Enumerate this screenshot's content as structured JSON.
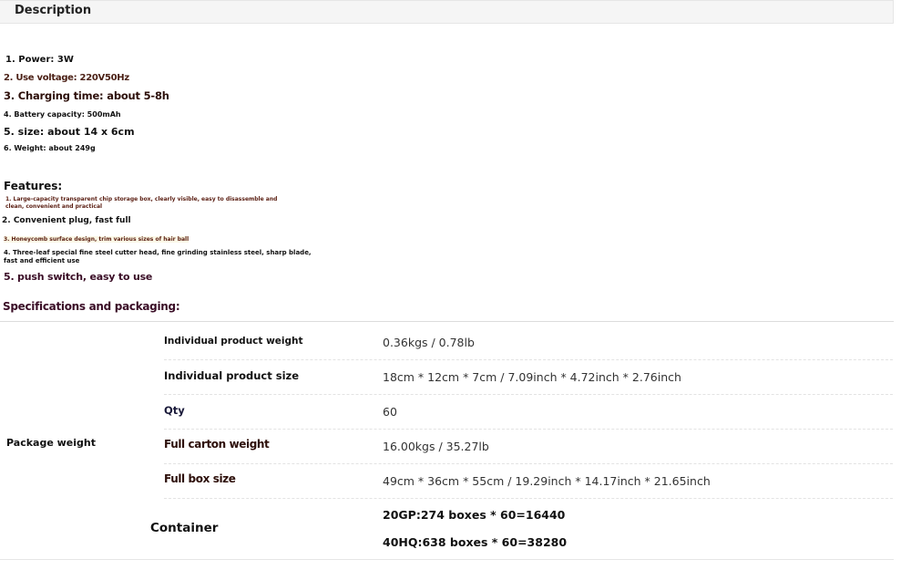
{
  "header": {
    "title": "Description"
  },
  "specs": [
    "1. Power: 3W",
    "2. Use voltage: 220V50Hz",
    "3. Charging time: about 5-8h",
    "4. Battery capacity: 500mAh",
    "5. size: about 14 x 6cm",
    "6. Weight: about 249g"
  ],
  "features": {
    "title": "Features:",
    "items": [
      "1. Large-capacity transparent chip storage box, clearly visible, easy to disassemble and clean, convenient and practical",
      "2. Convenient plug, fast full",
      "3. Honeycomb surface design, trim various sizes of hair ball",
      "4. Three-leaf special fine steel cutter head, fine grinding stainless steel, sharp blade, fast and efficient use",
      "5. push switch, easy to use"
    ]
  },
  "packaging": {
    "title": "Specifications and packaging:",
    "group_label": "Package weight",
    "rows": [
      {
        "label": "Individual product weight",
        "value": "0.36kgs / 0.78lb"
      },
      {
        "label": "Individual product size",
        "value": "18cm * 12cm * 7cm / 7.09inch * 4.72inch * 2.76inch"
      },
      {
        "label": "Qty",
        "value": "60"
      },
      {
        "label": "Full carton weight",
        "value": "16.00kgs / 35.27lb"
      },
      {
        "label": "Full box size",
        "value": "49cm * 36cm * 55cm / 19.29inch * 14.17inch * 21.65inch"
      }
    ],
    "container": {
      "label": "Container",
      "values": [
        "20GP:274 boxes * 60=16440",
        "40HQ:638 boxes * 60=38280"
      ]
    }
  }
}
